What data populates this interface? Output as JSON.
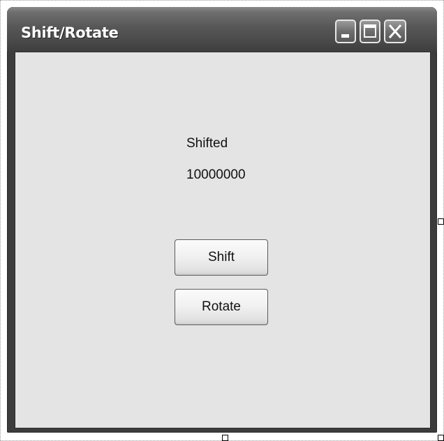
{
  "window": {
    "title": "Shift/Rotate"
  },
  "labels": {
    "caption": "Shifted",
    "value": "10000000"
  },
  "buttons": {
    "shift_label": "Shift",
    "rotate_label": "Rotate"
  },
  "title_buttons": {
    "minimize_icon": "minimize-icon",
    "maximize_icon": "maximize-icon",
    "close_icon": "close-icon"
  },
  "colors": {
    "titlebar": "#4a4a4a",
    "client": "#e4e4e4",
    "button_face": "#f0f0f0"
  }
}
